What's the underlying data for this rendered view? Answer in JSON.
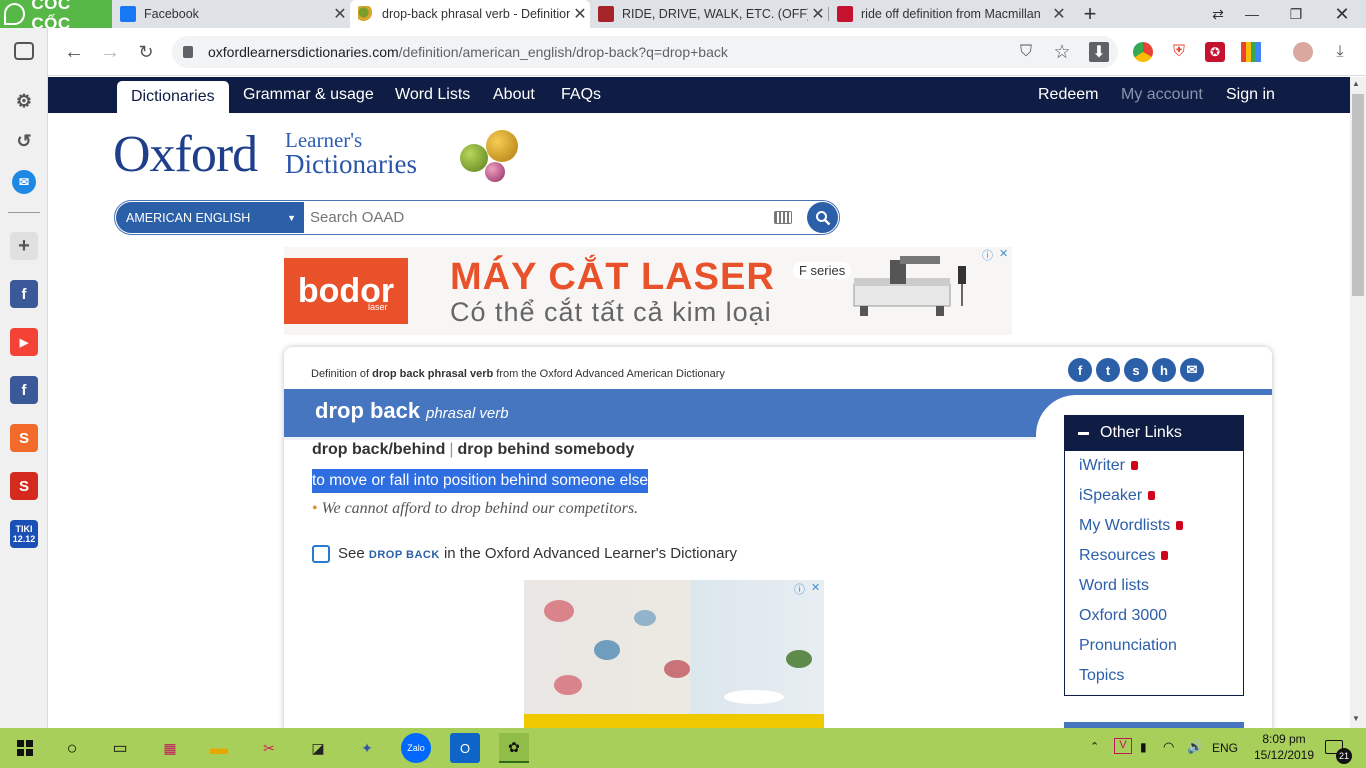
{
  "browser": {
    "brand": "CỐC CỐC",
    "tabs": [
      {
        "title": "Facebook",
        "active": false
      },
      {
        "title": "drop-back phrasal verb - Definition",
        "active": true
      },
      {
        "title": "RIDE, DRIVE, WALK, ETC. (OFF) INTO",
        "active": false
      },
      {
        "title": "ride off definition from Macmillan",
        "active": false
      }
    ],
    "new_tab": "+",
    "url_host": "oxfordlearnersdictionaries.com",
    "url_path": "/definition/american_english/drop-back?q=drop+back"
  },
  "site": {
    "nav": {
      "dictionaries": "Dictionaries",
      "grammar": "Grammar & usage",
      "word_lists": "Word Lists",
      "about": "About",
      "faqs": "FAQs",
      "redeem": "Redeem",
      "my_account": "My account",
      "sign_in": "Sign in"
    },
    "logo_main": "Oxford",
    "logo_sub1": "Learner's",
    "logo_sub2": "Dictionaries",
    "search": {
      "dialect": "AMERICAN ENGLISH",
      "placeholder": "Search OAAD"
    }
  },
  "ad_banner": {
    "brand": "bodor",
    "brand_sub": "laser",
    "title": "MÁY CẮT LASER",
    "subtitle": "Có thể cắt tất cả kim loại",
    "series": "F series"
  },
  "entry": {
    "source_prefix": "Definition of",
    "source_word": "drop back phrasal verb",
    "source_suffix": "from the Oxford Advanced American Dictionary",
    "headword": "drop back",
    "pos": "phrasal verb",
    "idiom_a": "drop back/behind",
    "idiom_sep": "|",
    "idiom_b": "drop behind somebody",
    "definition": "to move or fall into position behind someone else",
    "example_bullet": "•",
    "example": "We cannot afford to drop behind our competitors.",
    "see_prefix": "See",
    "see_word": "DROP BACK",
    "see_suffix": "in the Oxford Advanced Learner's Dictionary"
  },
  "other_links": {
    "title": "Other Links",
    "items": [
      {
        "label": "iWriter",
        "locked": true
      },
      {
        "label": "iSpeaker",
        "locked": true
      },
      {
        "label": "My Wordlists",
        "locked": true
      },
      {
        "label": "Resources",
        "locked": true
      },
      {
        "label": "Word lists",
        "locked": false
      },
      {
        "label": "Oxford 3000",
        "locked": false
      },
      {
        "label": "Pronunciation",
        "locked": false
      },
      {
        "label": "Topics",
        "locked": false
      }
    ]
  },
  "sidebar_rail": {
    "tiki_label": "TIKI",
    "tiki_sub": "12.12"
  },
  "taskbar": {
    "language": "ENG",
    "time": "8:09 pm",
    "date": "15/12/2019",
    "notifications": "21"
  },
  "colors": {
    "oxford_navy": "#0f1d44",
    "oxford_blue": "#4776c0",
    "highlight": "#2f6ee0",
    "taskbar": "#a7cf5a",
    "coccoc_green": "#58b847",
    "ad_orange": "#e8512a"
  }
}
